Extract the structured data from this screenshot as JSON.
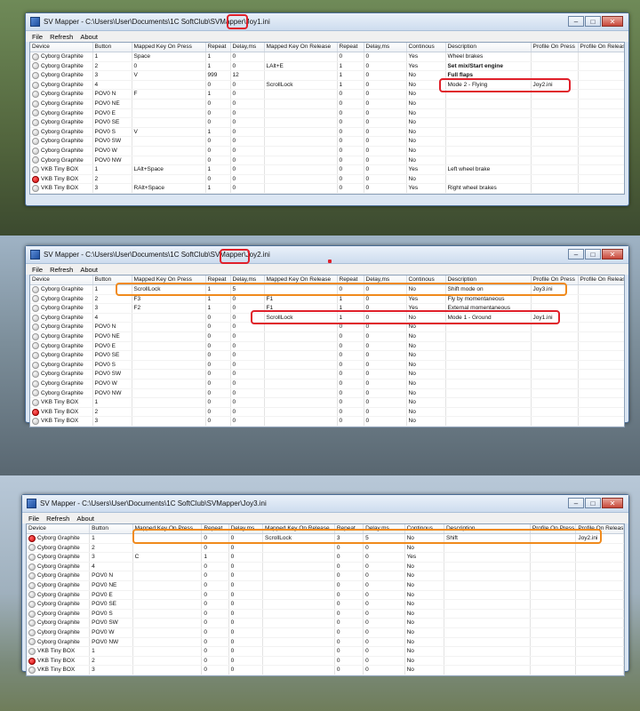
{
  "windows": [
    {
      "title_prefix": "SV Mapper - C:\\Users\\User\\Documents\\1C SoftClub\\SVMapper\\",
      "title_file": "Joy1.ini",
      "menu": [
        "File",
        "Refresh",
        "About"
      ],
      "columns": [
        "Device",
        "Button",
        "Mapped Key On Press",
        "Repeat",
        "Delay,ms",
        "Mapped Key On Release",
        "Repeat",
        "Delay,ms",
        "Continous",
        "Description",
        "Profile On Press",
        "Profile On Release"
      ],
      "rows": [
        {
          "on": false,
          "cells": [
            "Cyborg Graphite",
            "1",
            "Space",
            "1",
            "0",
            "",
            "0",
            "0",
            "Yes",
            "Wheel brakes",
            "",
            ""
          ]
        },
        {
          "on": false,
          "cells": [
            "Cyborg Graphite",
            "2",
            "0",
            "1",
            "0",
            "LAlt+E",
            "1",
            "0",
            "Yes",
            "Set mix/Start engine",
            "",
            ""
          ],
          "bold": 9
        },
        {
          "on": false,
          "cells": [
            "Cyborg Graphite",
            "3",
            "V",
            "999",
            "12",
            "",
            "1",
            "0",
            "No",
            "Full flaps",
            "",
            ""
          ],
          "bold": 9
        },
        {
          "on": false,
          "cells": [
            "Cyborg Graphite",
            "4",
            "",
            "0",
            "0",
            "ScrollLock",
            "1",
            "0",
            "No",
            "Mode 2 - Flying",
            "Joy2.ini",
            ""
          ]
        },
        {
          "on": false,
          "cells": [
            "Cyborg Graphite",
            "POV0 N",
            "F",
            "1",
            "0",
            "",
            "0",
            "0",
            "No",
            "",
            "",
            ""
          ]
        },
        {
          "on": false,
          "cells": [
            "Cyborg Graphite",
            "POV0 NE",
            "",
            "0",
            "0",
            "",
            "0",
            "0",
            "No",
            "",
            "",
            ""
          ]
        },
        {
          "on": false,
          "cells": [
            "Cyborg Graphite",
            "POV0 E",
            "",
            "0",
            "0",
            "",
            "0",
            "0",
            "No",
            "",
            "",
            ""
          ]
        },
        {
          "on": false,
          "cells": [
            "Cyborg Graphite",
            "POV0 SE",
            "",
            "0",
            "0",
            "",
            "0",
            "0",
            "No",
            "",
            "",
            ""
          ]
        },
        {
          "on": false,
          "cells": [
            "Cyborg Graphite",
            "POV0 S",
            "V",
            "1",
            "0",
            "",
            "0",
            "0",
            "No",
            "",
            "",
            ""
          ]
        },
        {
          "on": false,
          "cells": [
            "Cyborg Graphite",
            "POV0 SW",
            "",
            "0",
            "0",
            "",
            "0",
            "0",
            "No",
            "",
            "",
            ""
          ]
        },
        {
          "on": false,
          "cells": [
            "Cyborg Graphite",
            "POV0 W",
            "",
            "0",
            "0",
            "",
            "0",
            "0",
            "No",
            "",
            "",
            ""
          ]
        },
        {
          "on": false,
          "cells": [
            "Cyborg Graphite",
            "POV0 NW",
            "",
            "0",
            "0",
            "",
            "0",
            "0",
            "No",
            "",
            "",
            ""
          ]
        },
        {
          "on": false,
          "cells": [
            "VKB Tiny BOX",
            "1",
            "LAlt+Space",
            "1",
            "0",
            "",
            "0",
            "0",
            "Yes",
            "Left wheel brake",
            "",
            ""
          ]
        },
        {
          "on": true,
          "cells": [
            "VKB Tiny BOX",
            "2",
            "",
            "0",
            "0",
            "",
            "0",
            "0",
            "No",
            "",
            "",
            ""
          ]
        },
        {
          "on": false,
          "cells": [
            "VKB Tiny BOX",
            "3",
            "RAlt+Space",
            "1",
            "0",
            "",
            "0",
            "0",
            "Yes",
            "Right wheel brakes",
            "",
            ""
          ]
        }
      ]
    },
    {
      "title_prefix": "SV Mapper - C:\\Users\\User\\Documents\\1C SoftClub\\SVMapper\\",
      "title_file": "Joy2.ini",
      "menu": [
        "File",
        "Refresh",
        "About"
      ],
      "columns": [
        "Device",
        "Button",
        "Mapped Key On Press",
        "Repeat",
        "Delay,ms",
        "Mapped Key On Release",
        "Repeat",
        "Delay,ms",
        "Continous",
        "Description",
        "Profile On Press",
        "Profile On Release"
      ],
      "rows": [
        {
          "on": false,
          "cells": [
            "Cyborg Graphite",
            "1",
            "ScrollLock",
            "1",
            "5",
            "",
            "0",
            "0",
            "No",
            "Shift mode on",
            "Joy3.ini",
            ""
          ]
        },
        {
          "on": false,
          "cells": [
            "Cyborg Graphite",
            "2",
            "F3",
            "1",
            "0",
            "F1",
            "1",
            "0",
            "Yes",
            "Fly by momentaneous",
            "",
            ""
          ]
        },
        {
          "on": false,
          "cells": [
            "Cyborg Graphite",
            "3",
            "F2",
            "1",
            "0",
            "F1",
            "1",
            "0",
            "Yes",
            "External momentaneous",
            "",
            ""
          ]
        },
        {
          "on": false,
          "cells": [
            "Cyborg Graphite",
            "4",
            "",
            "0",
            "0",
            "ScrollLock",
            "1",
            "0",
            "No",
            "Mode 1 - Ground",
            "Joy1.ini",
            ""
          ]
        },
        {
          "on": false,
          "cells": [
            "Cyborg Graphite",
            "POV0 N",
            "",
            "0",
            "0",
            "",
            "0",
            "0",
            "No",
            "",
            "",
            ""
          ]
        },
        {
          "on": false,
          "cells": [
            "Cyborg Graphite",
            "POV0 NE",
            "",
            "0",
            "0",
            "",
            "0",
            "0",
            "No",
            "",
            "",
            ""
          ]
        },
        {
          "on": false,
          "cells": [
            "Cyborg Graphite",
            "POV0 E",
            "",
            "0",
            "0",
            "",
            "0",
            "0",
            "No",
            "",
            "",
            ""
          ]
        },
        {
          "on": false,
          "cells": [
            "Cyborg Graphite",
            "POV0 SE",
            "",
            "0",
            "0",
            "",
            "0",
            "0",
            "No",
            "",
            "",
            ""
          ]
        },
        {
          "on": false,
          "cells": [
            "Cyborg Graphite",
            "POV0 S",
            "",
            "0",
            "0",
            "",
            "0",
            "0",
            "No",
            "",
            "",
            ""
          ]
        },
        {
          "on": false,
          "cells": [
            "Cyborg Graphite",
            "POV0 SW",
            "",
            "0",
            "0",
            "",
            "0",
            "0",
            "No",
            "",
            "",
            ""
          ]
        },
        {
          "on": false,
          "cells": [
            "Cyborg Graphite",
            "POV0 W",
            "",
            "0",
            "0",
            "",
            "0",
            "0",
            "No",
            "",
            "",
            ""
          ]
        },
        {
          "on": false,
          "cells": [
            "Cyborg Graphite",
            "POV0 NW",
            "",
            "0",
            "0",
            "",
            "0",
            "0",
            "No",
            "",
            "",
            ""
          ]
        },
        {
          "on": false,
          "cells": [
            "VKB Tiny BOX",
            "1",
            "",
            "0",
            "0",
            "",
            "0",
            "0",
            "No",
            "",
            "",
            ""
          ]
        },
        {
          "on": true,
          "cells": [
            "VKB Tiny BOX",
            "2",
            "",
            "0",
            "0",
            "",
            "0",
            "0",
            "No",
            "",
            "",
            ""
          ]
        },
        {
          "on": false,
          "cells": [
            "VKB Tiny BOX",
            "3",
            "",
            "0",
            "0",
            "",
            "0",
            "0",
            "No",
            "",
            "",
            ""
          ]
        }
      ]
    },
    {
      "title_prefix": "SV Mapper - C:\\Users\\User\\Documents\\1C SoftClub\\SVMapper\\",
      "title_file": "Joy3.ini",
      "menu": [
        "File",
        "Refresh",
        "About"
      ],
      "columns": [
        "Device",
        "Button",
        "Mapped Key On Press",
        "Repeat",
        "Delay,ms",
        "Mapped Key On Release",
        "Repeat",
        "Delay,ms",
        "Continous",
        "Description",
        "Profile On Press",
        "Profile On Release"
      ],
      "rows": [
        {
          "on": true,
          "cells": [
            "Cyborg Graphite",
            "1",
            "",
            "0",
            "0",
            "ScrollLock",
            "3",
            "5",
            "No",
            "Shift",
            "",
            "Joy2.ini"
          ]
        },
        {
          "on": false,
          "cells": [
            "Cyborg Graphite",
            "2",
            "",
            "0",
            "0",
            "",
            "0",
            "0",
            "No",
            "",
            "",
            ""
          ]
        },
        {
          "on": false,
          "cells": [
            "Cyborg Graphite",
            "3",
            "C",
            "1",
            "0",
            "",
            "0",
            "0",
            "Yes",
            "",
            "",
            ""
          ]
        },
        {
          "on": false,
          "cells": [
            "Cyborg Graphite",
            "4",
            "",
            "0",
            "0",
            "",
            "0",
            "0",
            "No",
            "",
            "",
            ""
          ]
        },
        {
          "on": false,
          "cells": [
            "Cyborg Graphite",
            "POV0 N",
            "",
            "0",
            "0",
            "",
            "0",
            "0",
            "No",
            "",
            "",
            ""
          ]
        },
        {
          "on": false,
          "cells": [
            "Cyborg Graphite",
            "POV0 NE",
            "",
            "0",
            "0",
            "",
            "0",
            "0",
            "No",
            "",
            "",
            ""
          ]
        },
        {
          "on": false,
          "cells": [
            "Cyborg Graphite",
            "POV0 E",
            "",
            "0",
            "0",
            "",
            "0",
            "0",
            "No",
            "",
            "",
            ""
          ]
        },
        {
          "on": false,
          "cells": [
            "Cyborg Graphite",
            "POV0 SE",
            "",
            "0",
            "0",
            "",
            "0",
            "0",
            "No",
            "",
            "",
            ""
          ]
        },
        {
          "on": false,
          "cells": [
            "Cyborg Graphite",
            "POV0 S",
            "",
            "0",
            "0",
            "",
            "0",
            "0",
            "No",
            "",
            "",
            ""
          ]
        },
        {
          "on": false,
          "cells": [
            "Cyborg Graphite",
            "POV0 SW",
            "",
            "0",
            "0",
            "",
            "0",
            "0",
            "No",
            "",
            "",
            ""
          ]
        },
        {
          "on": false,
          "cells": [
            "Cyborg Graphite",
            "POV0 W",
            "",
            "0",
            "0",
            "",
            "0",
            "0",
            "No",
            "",
            "",
            ""
          ]
        },
        {
          "on": false,
          "cells": [
            "Cyborg Graphite",
            "POV0 NW",
            "",
            "0",
            "0",
            "",
            "0",
            "0",
            "No",
            "",
            "",
            ""
          ]
        },
        {
          "on": false,
          "cells": [
            "VKB Tiny BOX",
            "1",
            "",
            "0",
            "0",
            "",
            "0",
            "0",
            "No",
            "",
            "",
            ""
          ]
        },
        {
          "on": true,
          "cells": [
            "VKB Tiny BOX",
            "2",
            "",
            "0",
            "0",
            "",
            "0",
            "0",
            "No",
            "",
            "",
            ""
          ]
        },
        {
          "on": false,
          "cells": [
            "VKB Tiny BOX",
            "3",
            "",
            "0",
            "0",
            "",
            "0",
            "0",
            "No",
            "",
            "",
            ""
          ]
        }
      ]
    }
  ]
}
